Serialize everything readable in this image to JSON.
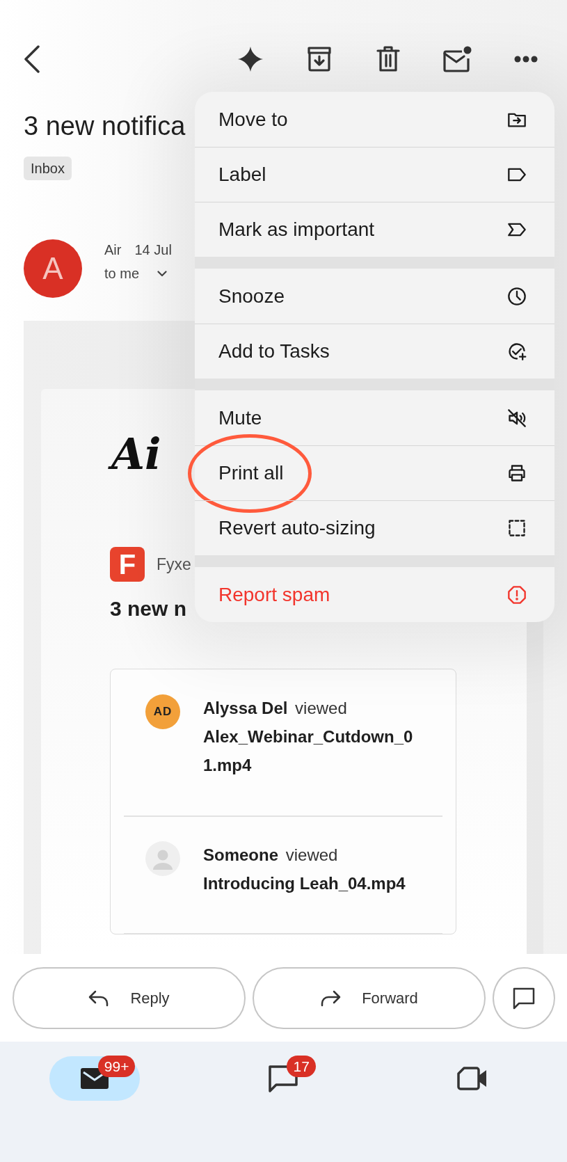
{
  "subject": "3 new notifica",
  "labels": [
    "Inbox"
  ],
  "sender": {
    "avatar_letter": "A",
    "name": "Air",
    "date": "14 Jul",
    "recipient": "to me"
  },
  "message": {
    "logo_text": "Ai",
    "brand": {
      "logo_letter": "F",
      "name": "Fyxe"
    },
    "heading": "3 new n",
    "activities": [
      {
        "avatar": {
          "kind": "initials",
          "text": "AD"
        },
        "summary": "**Alyssa Del** viewed",
        "file": "Alex_Webinar_Cutdown_01.mp4"
      },
      {
        "avatar": {
          "kind": "silhouette"
        },
        "summary": "**Someone** viewed",
        "file": "Introducing Leah_04.mp4"
      }
    ]
  },
  "menu": {
    "groups": [
      {
        "items": [
          {
            "label": "Move to",
            "kind": "move",
            "destructive": false,
            "circled": false
          },
          {
            "label": "Label",
            "kind": "label",
            "destructive": false,
            "circled": false
          },
          {
            "label": "Mark as important",
            "kind": "important",
            "destructive": false,
            "circled": false
          }
        ]
      },
      {
        "items": [
          {
            "label": "Snooze",
            "kind": "snooze",
            "destructive": false,
            "circled": false
          },
          {
            "label": "Add to Tasks",
            "kind": "task",
            "destructive": false,
            "circled": false
          }
        ]
      },
      {
        "items": [
          {
            "label": "Mute",
            "kind": "mute",
            "destructive": false,
            "circled": false
          },
          {
            "label": "Print all",
            "kind": "print",
            "destructive": false,
            "circled": true
          },
          {
            "label": "Revert auto-sizing",
            "kind": "resize",
            "destructive": false,
            "circled": false
          }
        ]
      },
      {
        "items": [
          {
            "label": "Report spam",
            "kind": "spam",
            "destructive": true,
            "circled": false
          }
        ]
      }
    ]
  },
  "actions": [
    {
      "kind": "reply",
      "label": "Reply"
    },
    {
      "kind": "forward",
      "label": "Forward"
    },
    {
      "kind": "chat"
    }
  ],
  "bottom_nav": [
    {
      "kind": "mail",
      "selected": true,
      "badge": "99+"
    },
    {
      "kind": "chat",
      "selected": false,
      "badge": "17"
    },
    {
      "kind": "meet",
      "selected": false
    }
  ]
}
